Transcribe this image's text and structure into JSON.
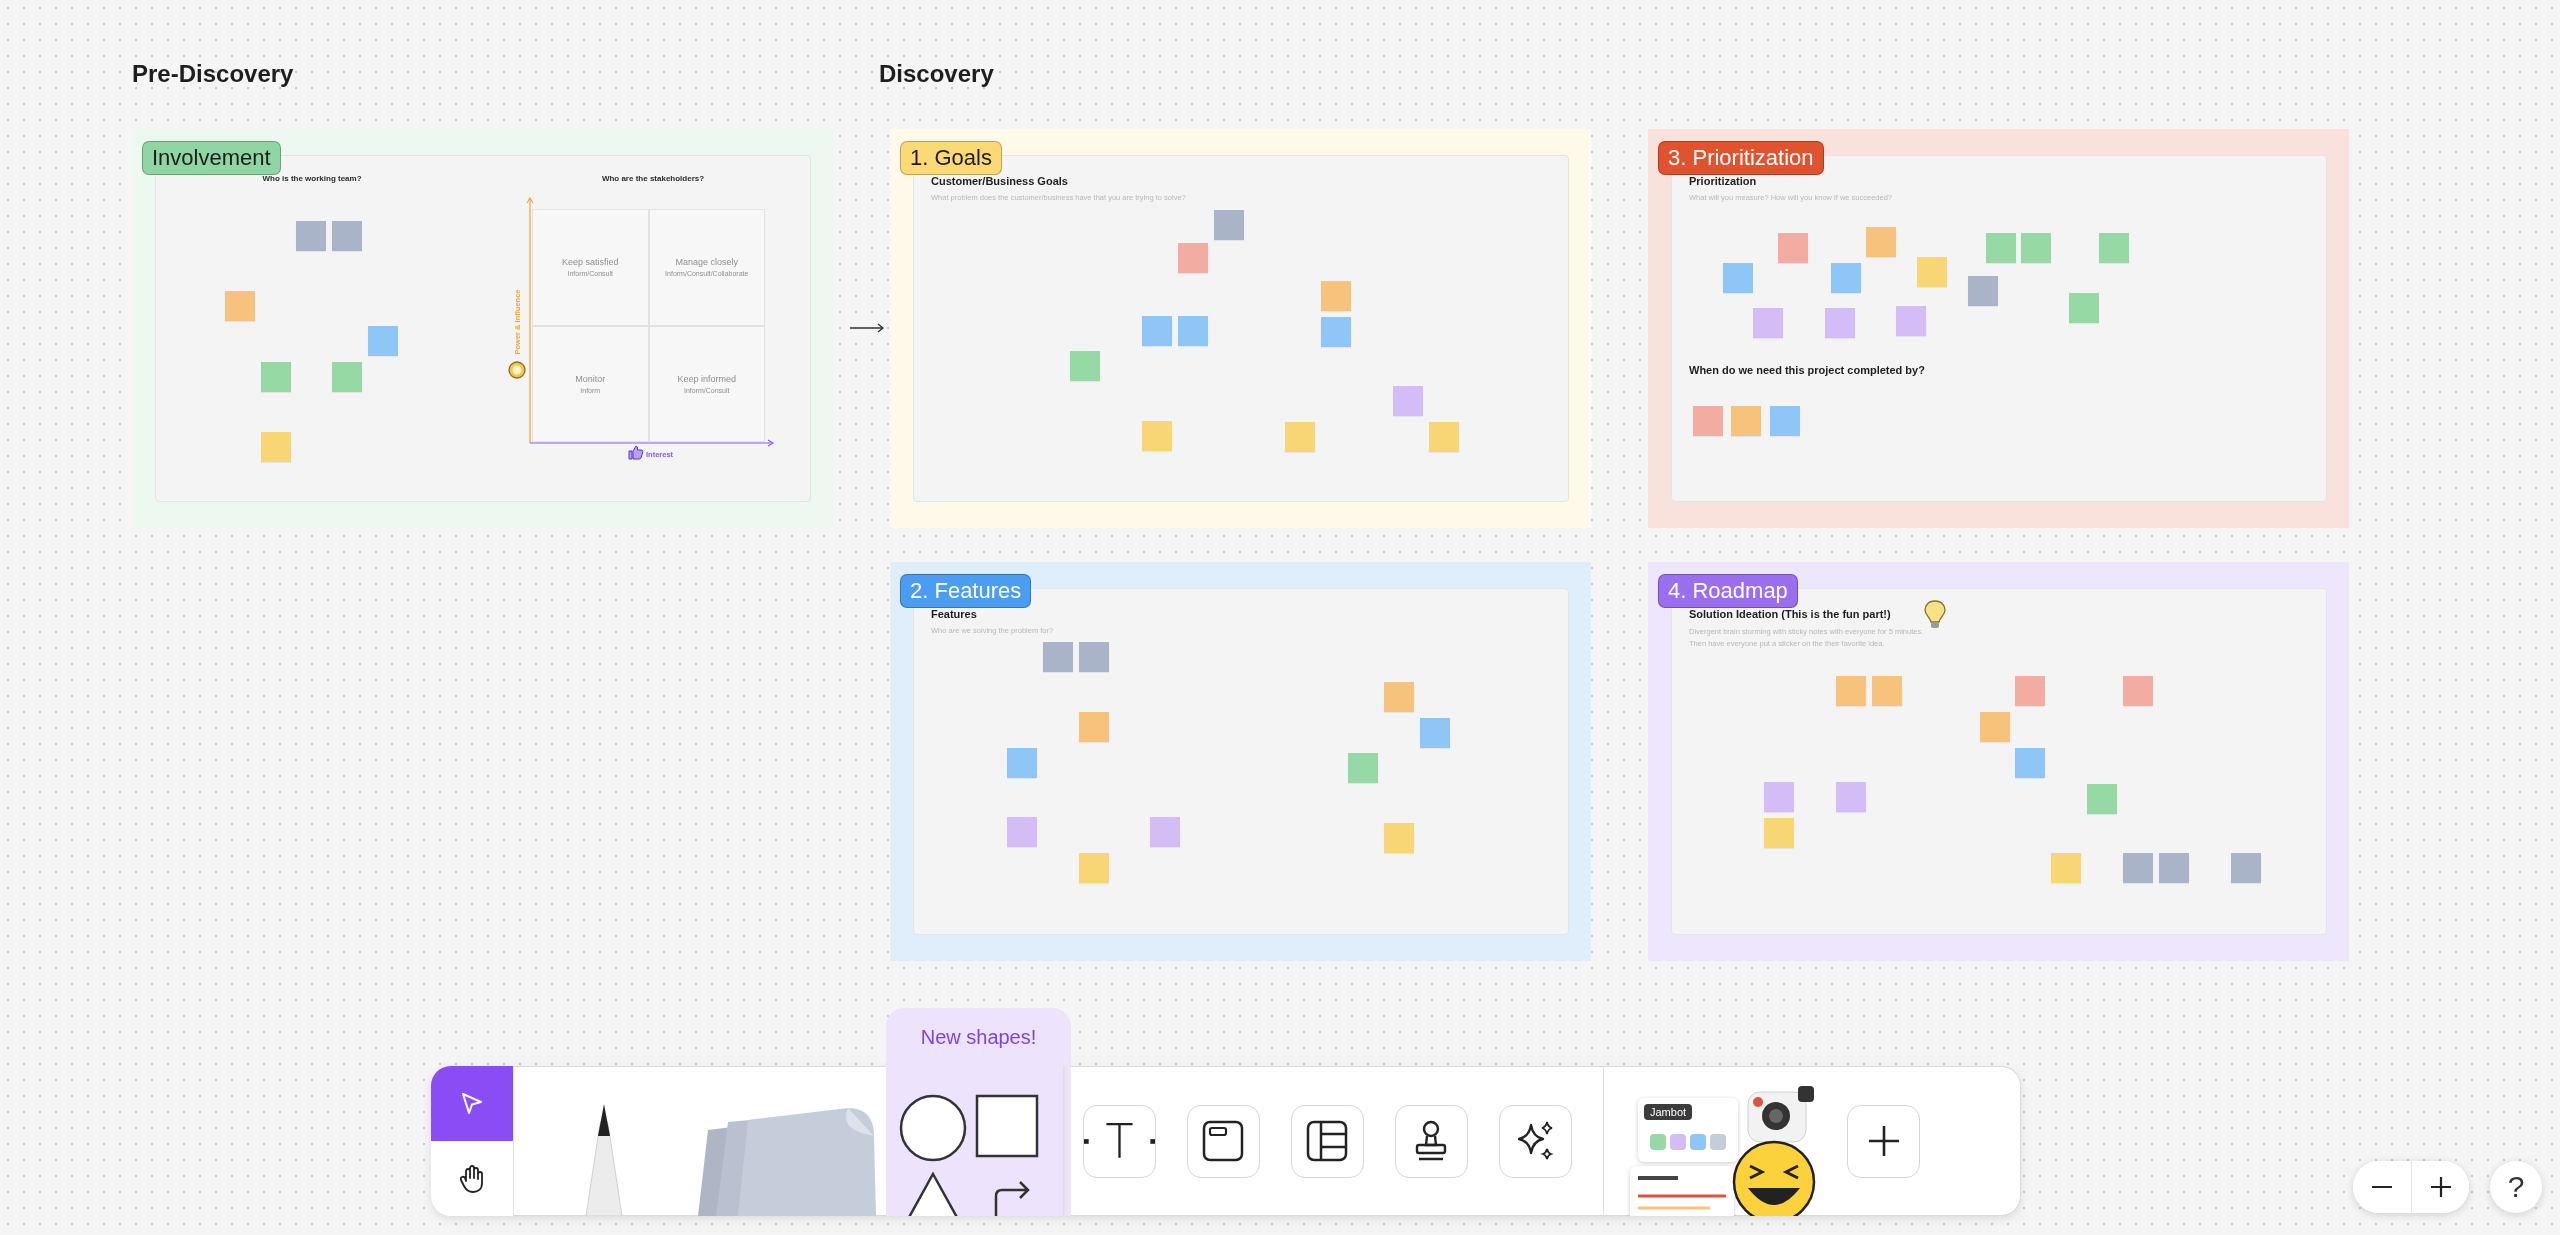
{
  "headings": [
    {
      "text": "Pre-Discovery"
    },
    {
      "text": "Discovery"
    }
  ],
  "sections": [
    {
      "kind": "matrix",
      "label": "Involvement",
      "color": "#8fd6a4",
      "team_title": "Who is the working team?",
      "stakeholder_title": "Who are the stakeholders?",
      "y_axis": "Power & Influence",
      "x_axis": "Interest",
      "quadrants": [
        {
          "title": "Keep satisfied",
          "subtitle": "Inform/Consult"
        },
        {
          "title": "Manage closely",
          "subtitle": "Inform/Consult/Collaborate"
        },
        {
          "title": "Monitor",
          "subtitle": "Inform"
        },
        {
          "title": "Keep informed",
          "subtitle": "Inform/Consult"
        }
      ],
      "stickies": [
        {
          "color": "#aab4c8"
        },
        {
          "color": "#aab4c8"
        },
        {
          "color": "#f7c27b"
        },
        {
          "color": "#8fc6f8"
        },
        {
          "color": "#96d9a5"
        },
        {
          "color": "#96d9a5"
        },
        {
          "color": "#f9d675"
        }
      ]
    },
    {
      "kind": "notes",
      "label": "1. Goals",
      "color": "#fbd977",
      "title": "Customer/Business Goals",
      "subtitle": "What problem does the customer/business have that you are trying to solve?",
      "stickies": [
        {
          "color": "#aab4c8"
        },
        {
          "color": "#f3aca1"
        },
        {
          "color": "#f7c27b"
        },
        {
          "color": "#8fc6f8"
        },
        {
          "color": "#8fc6f8"
        },
        {
          "color": "#8fc6f8"
        },
        {
          "color": "#96d9a5"
        },
        {
          "color": "#d4bdf6"
        },
        {
          "color": "#f9d675"
        },
        {
          "color": "#f9d675"
        },
        {
          "color": "#f9d675"
        }
      ]
    },
    {
      "kind": "notes",
      "label": "3. Prioritization",
      "color": "#e0532f",
      "title": "Prioritization",
      "subtitle": "What will you measure? How will you know if we succeeded?",
      "question": "When do we need this project completed by?",
      "stickies": [
        {
          "color": "#f3aca1"
        },
        {
          "color": "#f7c27b"
        },
        {
          "color": "#96d9a5"
        },
        {
          "color": "#96d9a5"
        },
        {
          "color": "#96d9a5"
        },
        {
          "color": "#8fc6f8"
        },
        {
          "color": "#8fc6f8"
        },
        {
          "color": "#f9d675"
        },
        {
          "color": "#aab4c8"
        },
        {
          "color": "#96d9a5"
        },
        {
          "color": "#d4bdf6"
        },
        {
          "color": "#d4bdf6"
        },
        {
          "color": "#d4bdf6"
        },
        {
          "color": "#f3aca1"
        },
        {
          "color": "#f7c27b"
        },
        {
          "color": "#8fc6f8"
        }
      ]
    },
    {
      "kind": "notes",
      "label": "2. Features",
      "color": "#4a9df0",
      "title": "Features",
      "subtitle": "Who are we solving the problem for?",
      "stickies": [
        {
          "color": "#aab4c8"
        },
        {
          "color": "#aab4c8"
        },
        {
          "color": "#f7c27b"
        },
        {
          "color": "#f7c27b"
        },
        {
          "color": "#8fc6f8"
        },
        {
          "color": "#8fc6f8"
        },
        {
          "color": "#96d9a5"
        },
        {
          "color": "#d4bdf6"
        },
        {
          "color": "#d4bdf6"
        },
        {
          "color": "#f9d675"
        },
        {
          "color": "#f9d675"
        }
      ]
    },
    {
      "kind": "ideation",
      "label": "4. Roadmap",
      "color": "#9b6ef0",
      "title": "Solution Ideation (This is the fun part!)",
      "subtitle": "Divergent brain storming with sticky notes with everyone for 5 minutes. Then have everyone put a sticker on the their favorite idea.",
      "stickies": [
        {
          "color": "#f7c27b"
        },
        {
          "color": "#f7c27b"
        },
        {
          "color": "#f3aca1"
        },
        {
          "color": "#f3aca1"
        },
        {
          "color": "#f7c27b"
        },
        {
          "color": "#8fc6f8"
        },
        {
          "color": "#d4bdf6"
        },
        {
          "color": "#d4bdf6"
        },
        {
          "color": "#96d9a5"
        },
        {
          "color": "#f9d675"
        },
        {
          "color": "#f9d675"
        },
        {
          "color": "#aab4c8"
        },
        {
          "color": "#aab4c8"
        },
        {
          "color": "#aab4c8"
        }
      ]
    }
  ],
  "toolbar": {
    "mode_tools": [
      {
        "kind": "select",
        "selected": true
      },
      {
        "kind": "hand",
        "selected": false
      }
    ],
    "tools": [
      {
        "kind": "pen"
      },
      {
        "kind": "stickies"
      },
      {
        "kind": "shapes",
        "badge": "New shapes!"
      },
      {
        "kind": "divider"
      },
      {
        "kind": "text"
      },
      {
        "kind": "section"
      },
      {
        "kind": "table"
      },
      {
        "kind": "stamp"
      },
      {
        "kind": "ai"
      },
      {
        "kind": "divider"
      },
      {
        "kind": "widgets",
        "label": "Jambot"
      },
      {
        "kind": "more"
      }
    ]
  },
  "zoom_controls": {
    "help": "?"
  }
}
